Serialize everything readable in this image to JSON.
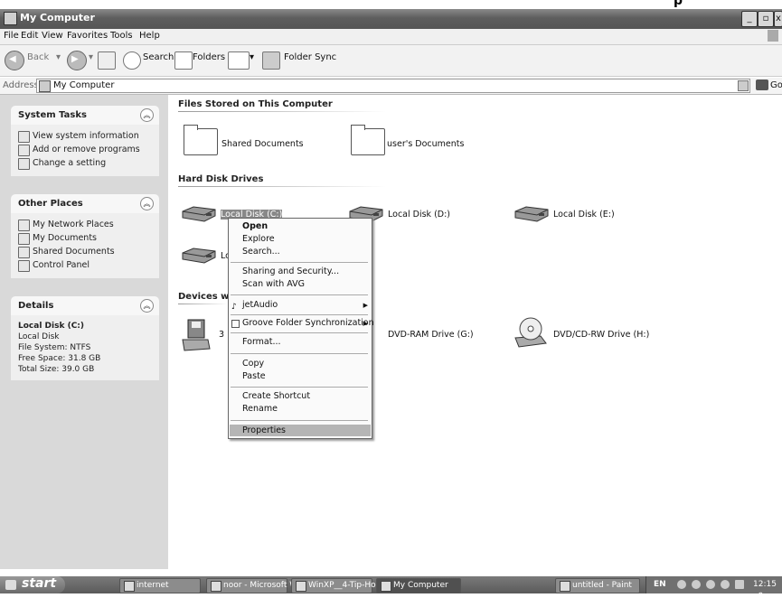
{
  "window": {
    "title": "My Computer",
    "header_fragment": "p"
  },
  "menubar": [
    "File",
    "Edit",
    "View",
    "Favorites",
    "Tools",
    "Help"
  ],
  "toolbar": {
    "back": "Back",
    "search": "Search",
    "folders": "Folders",
    "folder_sync": "Folder Sync"
  },
  "address": {
    "label": "Address",
    "value": "My Computer",
    "go": "Go"
  },
  "system_tasks": {
    "title": "System Tasks",
    "items": [
      "View system information",
      "Add or remove programs",
      "Change a setting"
    ]
  },
  "other_places": {
    "title": "Other Places",
    "items": [
      "My Network Places",
      "My Documents",
      "Shared Documents",
      "Control Panel"
    ]
  },
  "details": {
    "title": "Details",
    "name": "Local Disk (C:)",
    "type": "Local Disk",
    "fs": "File System: NTFS",
    "free": "Free Space: 31.8 GB",
    "total": "Total Size: 39.0 GB"
  },
  "sections": {
    "files": "Files Stored on This Computer",
    "hdd": "Hard Disk Drives",
    "devices": "Devices wit"
  },
  "files": [
    "Shared Documents",
    "user's Documents"
  ],
  "drives": [
    "Local Disk (C:)",
    "Local Disk (D:)",
    "Local Disk (E:)",
    "Lo"
  ],
  "devices": [
    "3",
    "DVD-RAM Drive (G:)",
    "DVD/CD-RW Drive (H:)"
  ],
  "context_menu": {
    "open": "Open",
    "explore": "Explore",
    "search": "Search...",
    "sharing": "Sharing and Security...",
    "scan": "Scan with AVG",
    "jetaudio": "jetAudio",
    "groove": "Groove Folder Synchronization",
    "format": "Format...",
    "copy": "Copy",
    "paste": "Paste",
    "shortcut": "Create Shortcut",
    "rename": "Rename",
    "properties": "Properties"
  },
  "taskbar": {
    "start": "start",
    "tasks": [
      "internet",
      "noor - Microsoft W...",
      "WinXP__4-Tip-Ho...",
      "My Computer",
      "untitled - Paint"
    ],
    "lang": "EN",
    "clock": "12:15 ص"
  }
}
